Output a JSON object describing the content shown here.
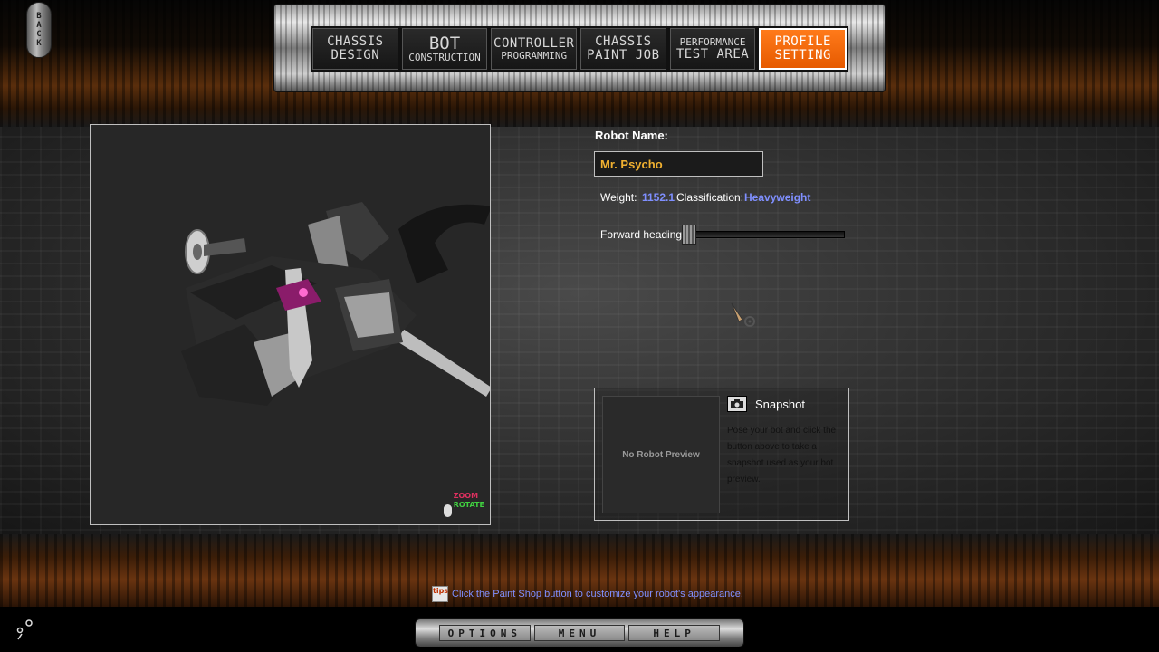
{
  "back_button": {
    "letters": [
      "B",
      "A",
      "C",
      "K"
    ]
  },
  "nav": {
    "tabs": [
      {
        "line1": "CHASSIS",
        "line2": "DESIGN",
        "active": false
      },
      {
        "line1": "BOT",
        "line2": "CONSTRUCTION",
        "active": false
      },
      {
        "line1": "CONTROLLER",
        "line2": "PROGRAMMING",
        "active": false
      },
      {
        "line1": "CHASSIS",
        "line2": "PAINT JOB",
        "active": false
      },
      {
        "line1": "PERFORMANCE",
        "line2": "TEST AREA",
        "active": false
      },
      {
        "line1": "PROFILE",
        "line2": "SETTING",
        "active": true
      }
    ],
    "active_color": "#ff6a00"
  },
  "viewport": {
    "hint_zoom": "ZOOM",
    "hint_rotate": "ROTATE",
    "zoom_color": "#e03060",
    "rotate_color": "#40d040"
  },
  "profile": {
    "name_label": "Robot Name:",
    "name_value": "Mr. Psycho",
    "weight_label": "Weight:",
    "weight_value": "1152.1",
    "class_label": "Classification:",
    "class_value": "Heavyweight",
    "heading_label": "Forward heading:"
  },
  "snapshot": {
    "title": "Snapshot",
    "preview_placeholder": "No Robot Preview",
    "description": "Pose your bot and click the button above to take a snapshot used as your bot preview."
  },
  "tip": {
    "icon_text": "tips",
    "text": "Click the Paint Shop button to customize your robot's appearance."
  },
  "bottom_bar": {
    "options": "OPTIONS",
    "menu": "MENU",
    "help": "HELP"
  },
  "colors": {
    "name_text": "#f0b030",
    "accent_blue": "#7f8fff"
  }
}
